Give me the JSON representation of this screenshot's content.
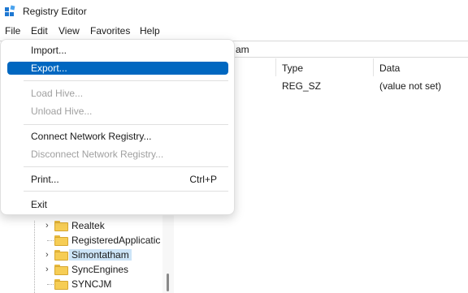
{
  "window": {
    "title": "Registry Editor",
    "icon": "registry-editor-icon"
  },
  "menubar": {
    "items": [
      "File",
      "Edit",
      "View",
      "Favorites",
      "Help"
    ]
  },
  "address": {
    "visible_text": "am"
  },
  "file_menu": {
    "items": [
      {
        "label": "Import...",
        "enabled": true
      },
      {
        "label": "Export...",
        "enabled": true,
        "highlighted": true
      },
      {
        "label": "Load Hive...",
        "enabled": false
      },
      {
        "label": "Unload Hive...",
        "enabled": false
      },
      {
        "label": "Connect Network Registry...",
        "enabled": true
      },
      {
        "label": "Disconnect Network Registry...",
        "enabled": false
      },
      {
        "label": "Print...",
        "enabled": true,
        "shortcut": "Ctrl+P"
      },
      {
        "label": "Exit",
        "enabled": true
      }
    ]
  },
  "tree": {
    "items": [
      {
        "label": "Realtek",
        "expandable": true
      },
      {
        "label": "RegisteredApplicatic",
        "expandable": false
      },
      {
        "label": "Simontatham",
        "expandable": true,
        "selected": true
      },
      {
        "label": "SyncEngines",
        "expandable": true
      },
      {
        "label": "SYNCJM",
        "expandable": false
      }
    ]
  },
  "values": {
    "columns": [
      "Type",
      "Data"
    ],
    "rows": [
      {
        "type": "REG_SZ",
        "data": "(value not set)"
      }
    ]
  },
  "colors": {
    "highlight": "#0067c0",
    "selection": "#cce4f7",
    "folder": "#f6cd55",
    "disabled_text": "#a0a0a0"
  }
}
